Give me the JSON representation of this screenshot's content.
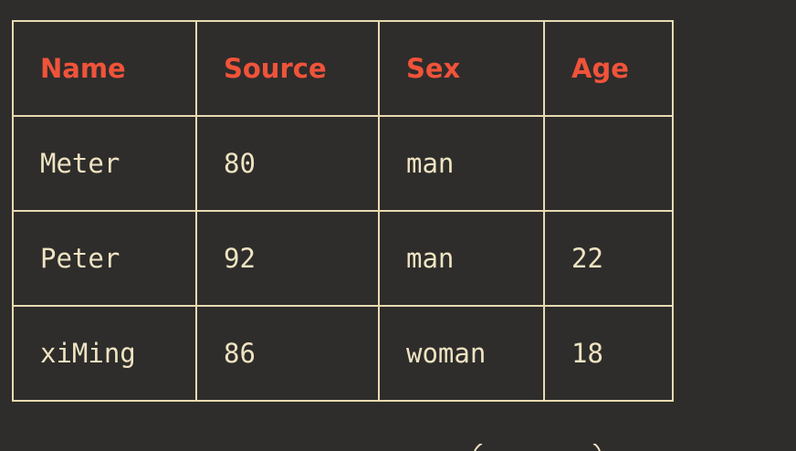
{
  "table": {
    "headers": [
      "Name",
      "Source",
      "Sex",
      "Age"
    ],
    "rows": [
      [
        "Meter",
        "80",
        "man",
        ""
      ],
      [
        "Peter",
        "92",
        "man",
        "22"
      ],
      [
        "xiMing",
        "86",
        "woman",
        "18"
      ]
    ]
  },
  "colors": {
    "background": "#2e2d2b",
    "border": "#e8dab0",
    "header_text": "#f0533a",
    "cell_text": "#efe3c2"
  }
}
